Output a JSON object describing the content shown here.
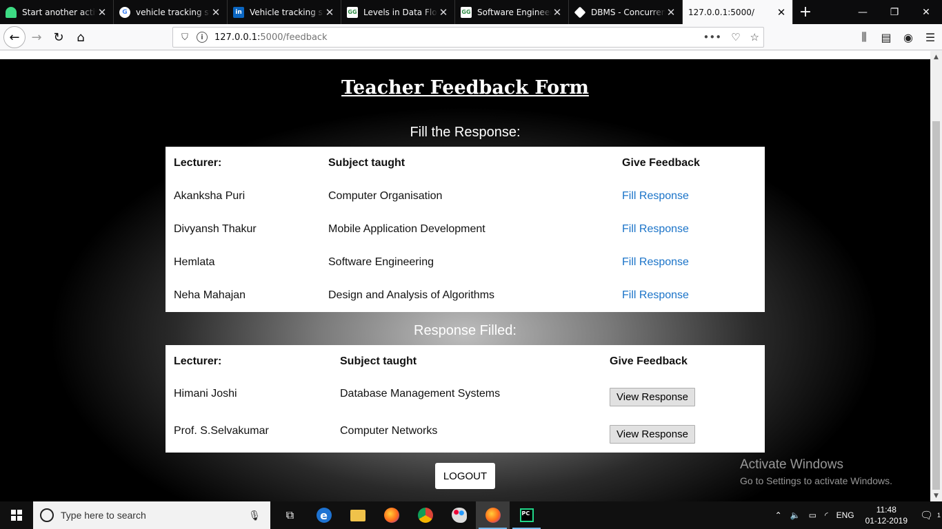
{
  "browser": {
    "tabs": [
      {
        "title": "Start another activit",
        "icon": "android-icon",
        "color": "#3ddc84"
      },
      {
        "title": "vehicle tracking syst",
        "icon": "google-icon",
        "color": "#ffffff"
      },
      {
        "title": "Vehicle tracking syst",
        "icon": "linkedin-icon",
        "color": "#0a66c2"
      },
      {
        "title": "Levels in Data Flow",
        "icon": "geeksforgeeks-icon",
        "color": "#2f8d46"
      },
      {
        "title": "Software Engineerin",
        "icon": "geeksforgeeks-icon",
        "color": "#2f8d46"
      },
      {
        "title": "DBMS - Concurrenc",
        "icon": "tutorialspoint-icon",
        "color": "#ffffff"
      },
      {
        "title": "127.0.0.1:5000/",
        "icon": "",
        "color": ""
      }
    ],
    "url_host": "127.0.0.1:",
    "url_path": "5000/feedback"
  },
  "page": {
    "title": "Teacher Feedback Form",
    "pending_title": "Fill the Response:",
    "filled_title": "Response Filled:",
    "headers": {
      "lecturer": "Lecturer:",
      "subject": "Subject taught",
      "feedback": "Give Feedback"
    },
    "pending": [
      {
        "lecturer": "Akanksha Puri",
        "subject": "Computer Organisation",
        "action": "Fill Response"
      },
      {
        "lecturer": "Divyansh Thakur",
        "subject": "Mobile Application Development",
        "action": "Fill Response"
      },
      {
        "lecturer": "Hemlata",
        "subject": "Software Engineering",
        "action": "Fill Response"
      },
      {
        "lecturer": "Neha Mahajan",
        "subject": "Design and Analysis of Algorithms",
        "action": "Fill Response"
      }
    ],
    "filled": [
      {
        "lecturer": "Himani Joshi",
        "subject": "Database Management Systems",
        "action": "View Response"
      },
      {
        "lecturer": "Prof. S.Selvakumar",
        "subject": "Computer Networks",
        "action": "View Response"
      }
    ],
    "logout_label": "LOGOUT"
  },
  "watermark": {
    "line1": "Activate Windows",
    "line2": "Go to Settings to activate Windows."
  },
  "taskbar": {
    "search_placeholder": "Type here to search",
    "language": "ENG",
    "time": "11:48",
    "date": "01-12-2019",
    "notification_count": "1"
  }
}
